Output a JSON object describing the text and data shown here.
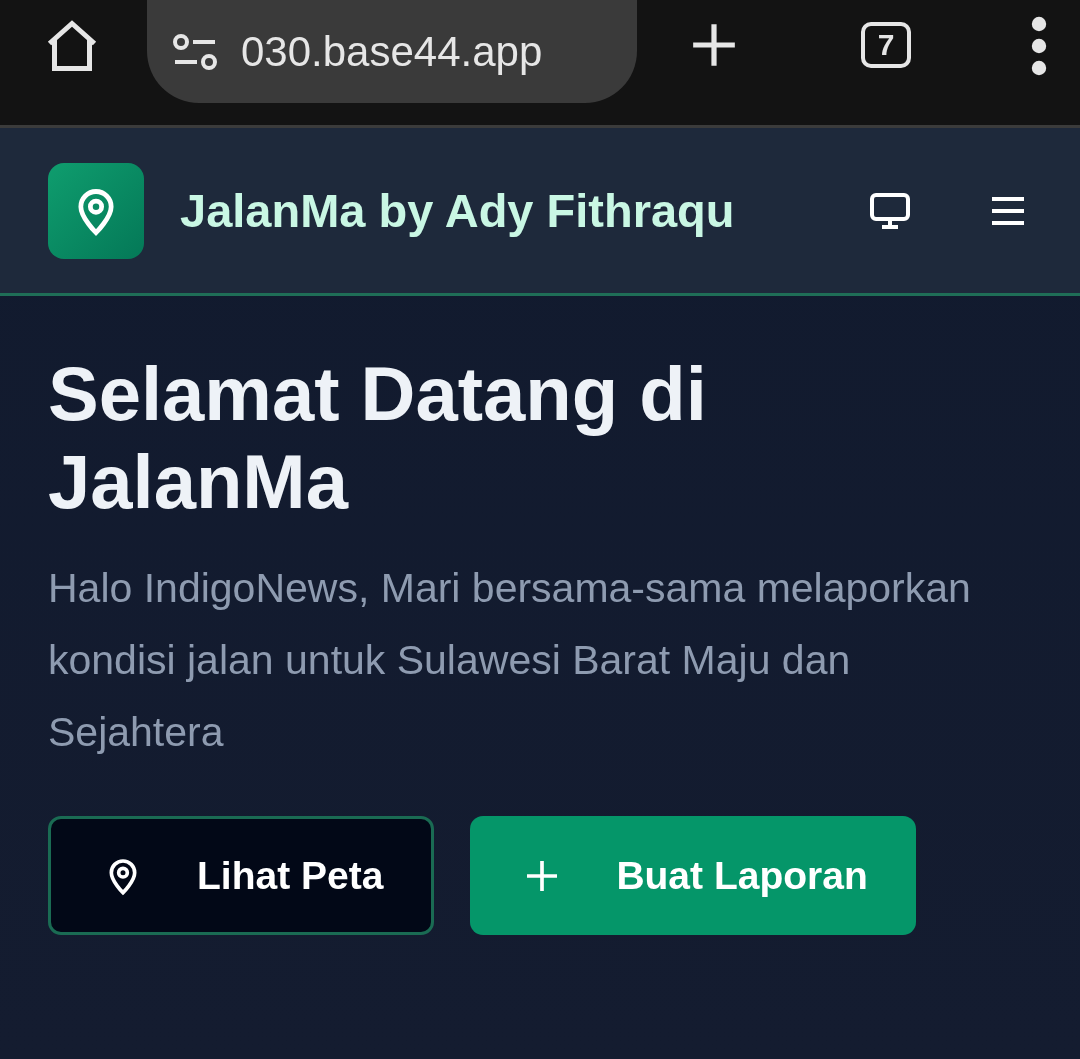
{
  "browser": {
    "url": "030.base44.app",
    "tab_count": "7"
  },
  "header": {
    "title": "JalanMa by Ady Fithraqu"
  },
  "hero": {
    "heading": "Selamat Datang di JalanMa",
    "text": "Halo IndigoNews, Mari bersama-sama melaporkan kondisi jalan untuk Sulawesi Barat Maju dan Sejahtera"
  },
  "buttons": [
    {
      "label": "Lihat Peta",
      "kind": "map"
    },
    {
      "label": "Buat Laporan",
      "kind": "create"
    }
  ]
}
